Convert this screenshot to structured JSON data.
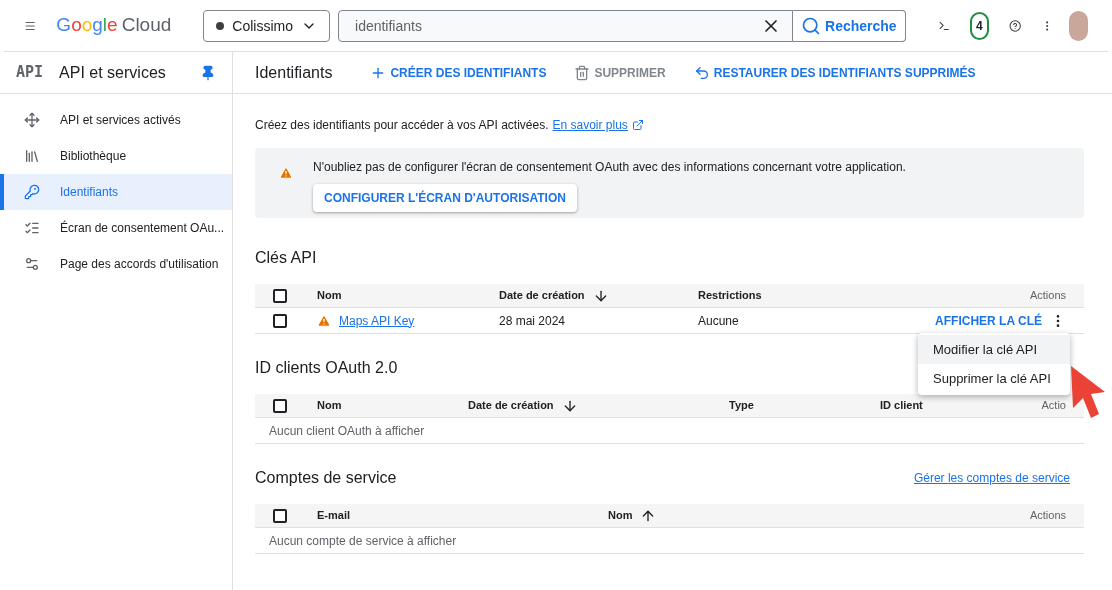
{
  "header": {
    "brand": "Google",
    "product": "Cloud",
    "project": "Colissimo",
    "search": {
      "value": "identifiants"
    },
    "search_button": "Recherche",
    "notifications": "4"
  },
  "sidebar": {
    "title": "API et services",
    "logo": "API",
    "items": [
      {
        "label": "API et services activés",
        "selected": false
      },
      {
        "label": "Bibliothèque",
        "selected": false
      },
      {
        "label": "Identifiants",
        "selected": true
      },
      {
        "label": "Écran de consentement OAu...",
        "selected": false
      },
      {
        "label": "Page des accords d'utilisation",
        "selected": false
      }
    ]
  },
  "toolbar": {
    "title": "Identifiants",
    "actions": [
      {
        "label": "CRÉER DES IDENTIFIANTS",
        "disabled": false
      },
      {
        "label": "SUPPRIMER",
        "disabled": true
      },
      {
        "label": "RESTAURER DES IDENTIFIANTS SUPPRIMÉS",
        "disabled": false
      }
    ]
  },
  "intro": {
    "text": "Créez des identifiants pour accéder à vos API activées.",
    "link": "En savoir plus"
  },
  "notice": {
    "text": "N'oubliez pas de configurer l'écran de consentement OAuth avec des informations concernant votre application.",
    "button": "CONFIGURER L'ÉCRAN D'AUTORISATION"
  },
  "sections": [
    {
      "title": "Clés API",
      "all_checked": false,
      "columns": [
        {
          "label": "Nom",
          "kind": "plain"
        },
        {
          "label": "Date de création",
          "kind": "sort-down"
        },
        {
          "label": "Restrictions",
          "kind": "plain"
        },
        {
          "label": "Actions",
          "kind": "plain"
        }
      ],
      "rows": [
        {
          "name": "Maps API Key",
          "warning": true,
          "checked": false,
          "date": "28 mai 2024",
          "restrictions": "Aucune",
          "action": "AFFICHER LA CLÉ"
        }
      ]
    },
    {
      "title": "ID clients OAuth 2.0",
      "all_checked": false,
      "columns": [
        {
          "label": "Nom",
          "kind": "plain"
        },
        {
          "label": "Date de création",
          "kind": "sort-down"
        },
        {
          "label": "Type",
          "kind": "plain"
        },
        {
          "label": "ID client",
          "kind": "plain"
        },
        {
          "label": "Actio",
          "kind": "plain"
        }
      ],
      "empty": "Aucun client OAuth à afficher"
    },
    {
      "title": "Comptes de service",
      "all_checked": false,
      "link": "Gérer les comptes de service",
      "columns": [
        {
          "label": "E-mail",
          "kind": "plain"
        },
        {
          "label": "Nom",
          "kind": "sort-up"
        },
        {
          "label": "Actions",
          "kind": "plain"
        }
      ],
      "empty": "Aucun compte de service à afficher"
    }
  ],
  "menu": [
    {
      "label": "Modifier la clé API",
      "selected": true
    },
    {
      "label": "Supprimer la clé API",
      "selected": false
    }
  ]
}
